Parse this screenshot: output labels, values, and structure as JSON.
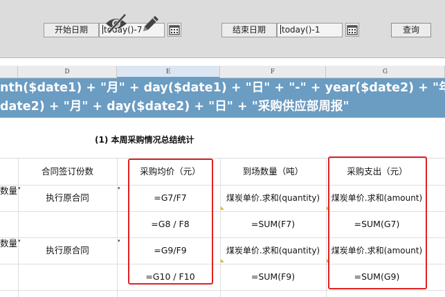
{
  "toolbar": {
    "start_date_label": "开始日期",
    "start_date_value": "today()-7",
    "end_date_label": "结束日期",
    "end_date_value": "today()-1",
    "query_label": "查询",
    "hidden_icon": "eye-slash-icon",
    "edit_icon": "pencil-icon",
    "calendar_icon": "calendar-icon"
  },
  "columns": [
    "D",
    "E",
    "F",
    "G"
  ],
  "title": {
    "line1": "nth($date1) + \"月\" + day($date1) + \"日\" + \"-\" + year($date2) + \"年",
    "line2": "date2) + \"月\" + day($date2) + \"日\" + \"采购供应部周报\""
  },
  "section_heading": "(1) 本周采购情况总结统计",
  "table": {
    "headers": {
      "contracts": "合同签订份数",
      "avg_price": "采购均价（元）",
      "arrival_qty": "到场数量（吨）",
      "spending": "采购支出（元）"
    },
    "left_stub": "数量.",
    "rows": [
      {
        "contracts": "执行原合同",
        "avg_price": "=G7/F7",
        "arrival_qty": "煤炭单价.求和(quantity)",
        "spending": "煤炭单价.求和(amount)"
      },
      {
        "contracts": "",
        "avg_price": "=G8 / F8",
        "arrival_qty": "=SUM(F7)",
        "spending": "=SUM(G7)"
      },
      {
        "contracts": "执行原合同",
        "avg_price": "=G9/F9",
        "arrival_qty": "煤炭单价.求和(quantity)",
        "spending": "煤炭单价.求和(amount)"
      },
      {
        "contracts": "",
        "avg_price": "=G10 / F10",
        "arrival_qty": "=SUM(F9)",
        "spending": "=SUM(G9)"
      }
    ]
  },
  "colors": {
    "title_band": "#6b9cc2",
    "highlight": "#e0201f",
    "toolbar": "#dcdcdc"
  }
}
